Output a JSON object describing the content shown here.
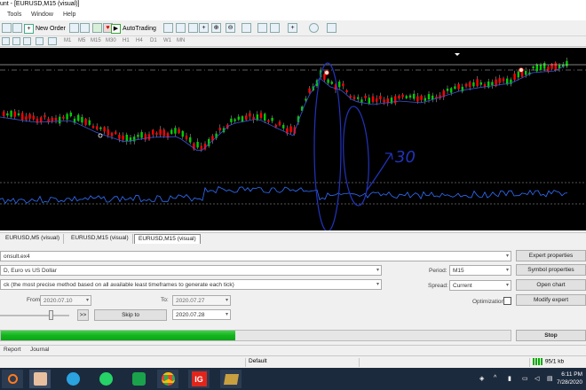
{
  "window": {
    "title": "unt - [EURUSD,M15 (visual)]"
  },
  "menu": [
    "Tools",
    "Window",
    "Help"
  ],
  "toolbar": {
    "new_order": "New Order",
    "auto_trading": "AutoTrading"
  },
  "timeframes": [
    "M1",
    "M5",
    "M15",
    "M30",
    "H1",
    "H4",
    "D1",
    "W1",
    "MN"
  ],
  "chart": {
    "annotation": "30",
    "colors": {
      "bg": "#000000",
      "bull": "#00cc00",
      "bear": "#ff0000",
      "ma": "#3a55d6",
      "indicator": "#3070ff",
      "drawing": "#2233bb"
    }
  },
  "chart_tabs": [
    "EURUSD,M5 (visual)",
    "EURUSD,M15 (visual)",
    "EURUSD,M15 (visual)"
  ],
  "tester": {
    "expert": "onsult.ex4",
    "symbol": "D, Euro vs US Dollar",
    "model": "ck (the most precise method based on all available least timeframes to generate each tick)",
    "from_label": "From:",
    "from_date": "2020.07.10",
    "to_label": "To:",
    "to_date": "2020.07.27",
    "skip_to_label": "Skip to",
    "skip_date": "2020.07.28",
    "fast_forward": ">>",
    "period_label": "Period:",
    "period_value": "M15",
    "spread_label": "Spread:",
    "spread_value": "Current",
    "optimization_label": "Optimization",
    "buttons": {
      "expert_properties": "Expert properties",
      "symbol_properties": "Symbol properties",
      "open_chart": "Open chart",
      "modify_expert": "Modify expert",
      "stop": "Stop"
    },
    "progress": 0.46
  },
  "bottom_tabs": [
    "Report",
    "Journal"
  ],
  "status": {
    "profile": "Default",
    "traffic": "95/1 kb"
  },
  "taskbar": {
    "time": "6:11 PM",
    "date": "7/28/2020",
    "apps": [
      "search-app",
      "paint-app",
      "telegram-app",
      "whatsapp-app",
      "green-app",
      "chrome-app",
      "ig-app",
      "metatrader-app"
    ]
  }
}
